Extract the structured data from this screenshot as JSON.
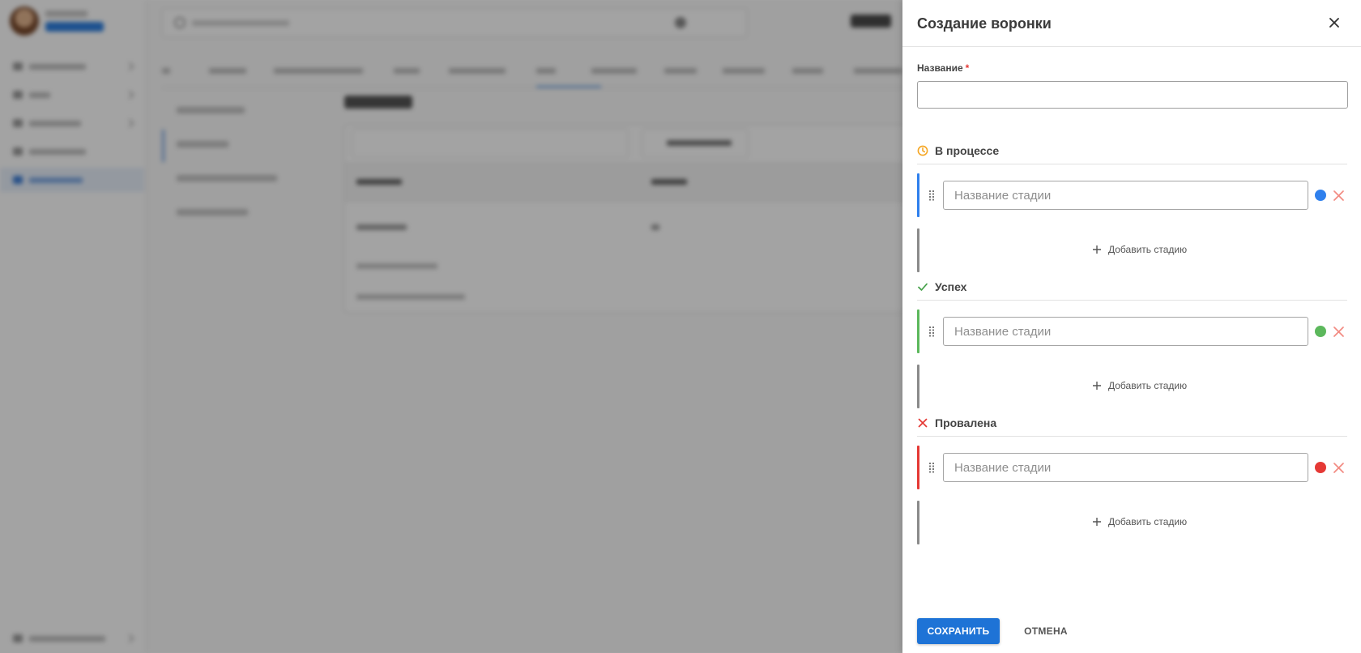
{
  "drawer": {
    "title": "Создание воронки",
    "close_icon": "close-icon",
    "name_label": "Название",
    "name_required_mark": "*",
    "name_value": ""
  },
  "sections": [
    {
      "key": "in_progress",
      "title": "В процессе",
      "icon": "clock-icon",
      "icon_color": "#f5a623",
      "stage_color": "#2f80ed",
      "stage_placeholder": "Название стадии",
      "add_label": "Добавить стадию"
    },
    {
      "key": "success",
      "title": "Успех",
      "icon": "check-icon",
      "icon_color": "#43a047",
      "stage_color": "#5cb85c",
      "stage_placeholder": "Название стадии",
      "add_label": "Добавить стадию"
    },
    {
      "key": "failed",
      "title": "Провалена",
      "icon": "cross-icon",
      "icon_color": "#e53935",
      "stage_color": "#e53935",
      "stage_placeholder": "Название стадии",
      "add_label": "Добавить стадию"
    }
  ],
  "footer": {
    "save_label": "СОХРАНИТЬ",
    "cancel_label": "ОТМЕНА"
  },
  "colors": {
    "primary": "#1e73d6",
    "remove_icon": "#f28b82",
    "add_accent": "#8a8a8a"
  }
}
